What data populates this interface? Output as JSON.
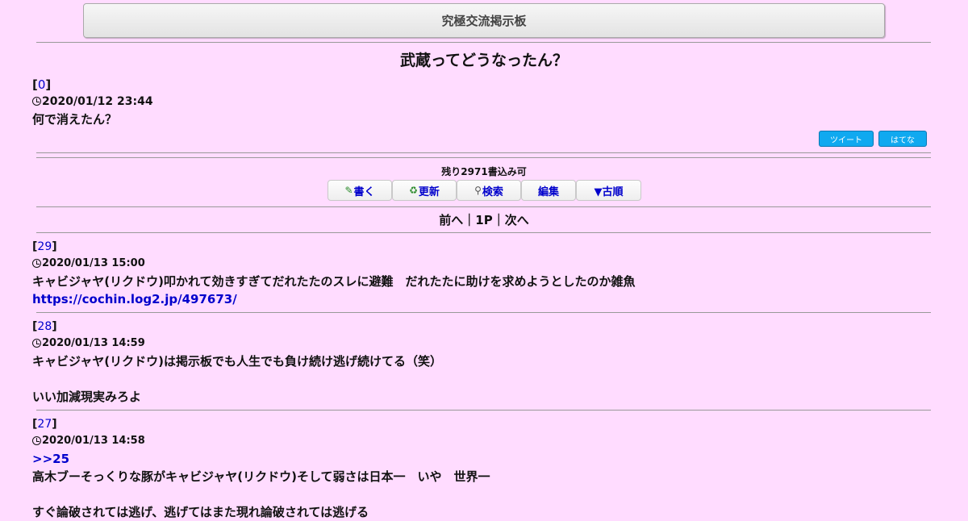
{
  "board": {
    "title": "究極交流掲示板"
  },
  "thread": {
    "title": "武蔵ってどうなったん？"
  },
  "op": {
    "number": "0",
    "date": "2020/01/12 23:44",
    "body": "何で消えたん？"
  },
  "share": {
    "tweet": "ツイート",
    "hatena": "はてな"
  },
  "remaining": "残り2971書込み可",
  "toolbar": {
    "write": "書く",
    "refresh": "更新",
    "search": "検索",
    "edit": "編集",
    "order": "▼古順"
  },
  "pager": {
    "prev": "前へ",
    "sep1": "｜",
    "page": "1P",
    "sep2": "｜",
    "next": "次へ"
  },
  "posts": [
    {
      "number": "29",
      "date": "2020/01/13 15:00",
      "lines": [
        "キャビジャヤ(リクドウ)叩かれて効きすぎてだれたたのスレに避難　だれたたに助けを求めようとしたのか雑魚"
      ],
      "link": "https://cochin.log2.jp/497673/"
    },
    {
      "number": "28",
      "date": "2020/01/13 14:59",
      "lines": [
        "キャビジャヤ(リクドウ)は掲示板でも人生でも負け続け逃げ続けてる（笑）",
        "いい加減現実みろよ"
      ]
    },
    {
      "number": "27",
      "date": "2020/01/13 14:58",
      "anchor": ">>25",
      "lines": [
        "高木ブーそっくりな豚がキャビジャヤ(リクドウ)そして弱さは日本一　いや　世界一",
        "すぐ論破されては逃げ、逃げてはまた現れ論破されては逃げる"
      ]
    }
  ]
}
